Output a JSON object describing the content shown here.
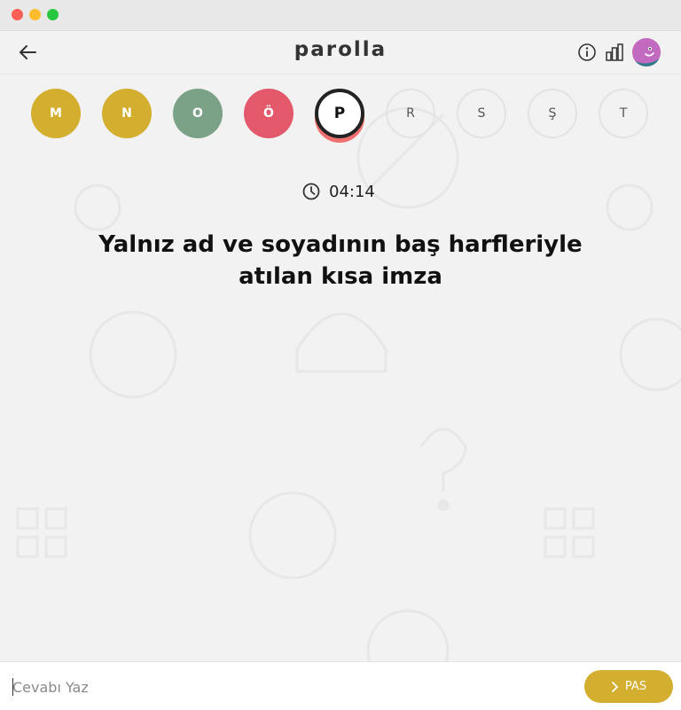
{
  "header": {
    "logo": "parolla",
    "icons": [
      "back-arrow-icon",
      "info-icon",
      "stats-icon",
      "avatar"
    ]
  },
  "letters": [
    {
      "char": "M",
      "status": "correct"
    },
    {
      "char": "N",
      "status": "correct"
    },
    {
      "char": "O",
      "status": "right"
    },
    {
      "char": "Ö",
      "status": "wrong"
    },
    {
      "char": "P",
      "status": "active"
    },
    {
      "char": "R",
      "status": "pending"
    },
    {
      "char": "S",
      "status": "pending"
    },
    {
      "char": "Ş",
      "status": "pending"
    },
    {
      "char": "T",
      "status": "pending"
    }
  ],
  "timer": {
    "value": "04:14",
    "icon": "clock-icon"
  },
  "question": {
    "line1": "Yalnız ad ve soyadının baş harfleriyle",
    "line2": "atılan kısa imza"
  },
  "answer": {
    "placeholder": "Cevabı Yaz",
    "value": "",
    "pass_label": "PAS"
  },
  "colors": {
    "accent_yellow": "#d4ae2f",
    "green": "#7ba286",
    "red": "#e3596b",
    "background": "#f2f2f2"
  }
}
